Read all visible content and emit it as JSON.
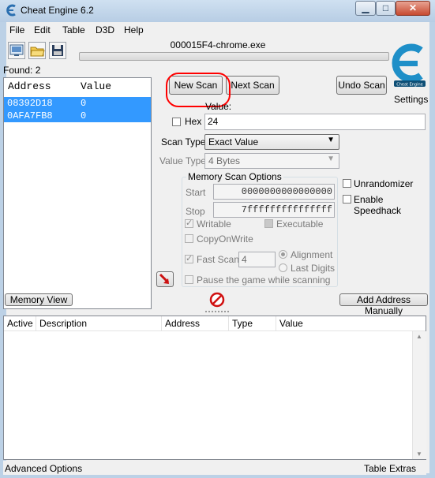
{
  "window": {
    "title": "Cheat Engine 6.2",
    "controls": {
      "minimize": "▁",
      "maximize": "□",
      "close": "✕"
    }
  },
  "menu": [
    "File",
    "Edit",
    "Table",
    "D3D",
    "Help"
  ],
  "toolbar": {
    "process_name": "000015F4-chrome.exe",
    "icons": [
      "open-process-icon",
      "open-folder-icon",
      "save-icon"
    ]
  },
  "found": "Found: 2",
  "results": {
    "columns": [
      "Address",
      "Value"
    ],
    "rows": [
      {
        "address": "08392D18",
        "value": "0"
      },
      {
        "address": "0AFA7FB8",
        "value": "0"
      }
    ]
  },
  "scan": {
    "new_scan": "New Scan",
    "next_scan": "Next Scan",
    "undo_scan": "Undo Scan",
    "settings": "Settings",
    "value_label": "Value:",
    "hex_label": "Hex",
    "value": "24",
    "scan_type_label": "Scan Type",
    "scan_type": "Exact Value",
    "value_type_label": "Value Type",
    "value_type": "4 Bytes",
    "memory_options_title": "Memory Scan Options",
    "start_label": "Start",
    "start": "0000000000000000",
    "stop_label": "Stop",
    "stop": "7fffffffffffffff",
    "writable": "Writable",
    "executable": "Executable",
    "copy_on_write": "CopyOnWrite",
    "fast_scan": "Fast Scan",
    "fast_scan_value": "4",
    "alignment": "Alignment",
    "last_digits": "Last Digits",
    "pause_game": "Pause the game while scanning",
    "unrandomizer": "Unrandomizer",
    "enable_speedhack": "Enable Speedhack"
  },
  "actions": {
    "memory_view": "Memory View",
    "add_address": "Add Address Manually"
  },
  "cheat_table": {
    "columns": [
      "Active",
      "Description",
      "Address",
      "Type",
      "Value"
    ]
  },
  "status": {
    "advanced_options": "Advanced Options",
    "table_extras": "Table Extras"
  },
  "colors": {
    "selection": "#3399ff",
    "annotation": "#ff0000",
    "logo": "#1e8fc8"
  }
}
